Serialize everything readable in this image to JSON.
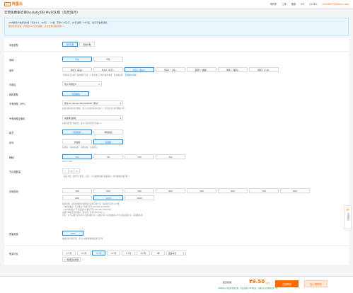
{
  "topbar": {
    "logo_mark": "(-)",
    "logo_text": "阿里云",
    "links": [
      "购物车",
      "工单",
      "备案",
      "ICP",
      "$138%",
      "a13586***@aliyun.com"
    ]
  },
  "page_title": "云原生数据仓库AnalyticDB MySQL版（包年包月）",
  "notice": {
    "line1": "ADB新用户免费领6核（可扩1.5，10天），72核（可扩1.0元/元，16天试用）73行后，最高可免费试用。",
    "line2": "限时优惠活动：开通送100元代金券，点击查看活动详情>>"
  },
  "sections": {
    "billing_label": "商品类型",
    "billing_options": [
      "包年包月",
      "按量付费"
    ],
    "region_label": "地域",
    "region_top": [
      "华北",
      "华东"
    ],
    "region_sub_label": "城市",
    "region_options": [
      "华北1（青岛）",
      "华北2（北京）",
      "华东1（杭州）",
      "华东2（上海）",
      "西南1（成都）",
      "华南1（深圳）",
      "华南3（广州）"
    ],
    "region_hint": "不同地域之间的产品内网不互通，订单生效后不支持更换地域，请谨慎选择。",
    "region_hint_link": "查看我的地域",
    "zone_label": "可用区",
    "zone_value": "杭州 可用区H",
    "network_label": "网络类型",
    "network_option": "专有网络",
    "vpc_label": "专有网络（VPC）",
    "vpc_value": "默认vpc-bp1vpcl6xp3sz9k0t（默认）",
    "vpc_hint": "如需创建新的专有网络，您可以前往控制台创建>> 当前仅支持专有网络VPC。",
    "vswitch_label": "专有网络交换机",
    "vswitch_value": "请选择交换机",
    "vswitch_hint": "如需创建新的交换机，您可以前往控制台创建>>",
    "mode_label": "模式",
    "mode_options": [
      "预留模式",
      "弹性模式"
    ],
    "series_label": "系列",
    "series_options": [
      "高性能",
      "基础版"
    ],
    "series_hint": "基础版，单副本集群，免费试用，价格便宜。",
    "spec_label": "规格",
    "spec_options": [
      "T32",
      "T8",
      "T16",
      "T52"
    ],
    "spec_hint": "C8N 1.5GB",
    "node_label": "节点组数量",
    "node_value": "1",
    "node_hint": "（最多5组，选择节点数目，注意：节点组数目越多性能越好，请您根据需要选择。）",
    "storage_label": "存储空间",
    "storage_row1": [
      "100",
      "200",
      "300",
      "400",
      "500",
      "600",
      "700",
      "800"
    ],
    "storage_row2": [
      "900",
      "1000",
      "2000"
    ],
    "storage_hint1": "规格说明：主机规格中存储容量为实际可用空间，按存储空间大小计费。",
    "storage_hint2": "- C8N规格每个节点组最大存储空间为1000GB-10000GB。",
    "storage_hint3": "- C32N规格每个节点组最大存储空间为2000GB-10000GB。",
    "storage_hint4": "存储空间越大性能越好，建议至少选择1000GB以上。",
    "storage_hint5": "注意：以上存储空间为单节点组存储空间，存储空间=节点组数量×单节点组存储空间，请谨慎选择。",
    "backup_label": "预留资源",
    "backup_value": "1000",
    "backup_hint": "数据备份存储空间，您可以根据数据规模进行选择。",
    "duration_label": "购买时长",
    "duration_options": [
      "1个月",
      "2个月",
      "3个月",
      "4个月",
      "5个月",
      "6个月",
      "1年"
    ],
    "duration_select": "更多时长",
    "autorenew_label": "到期自动续费"
  },
  "bottom": {
    "price_label": "配置费用：",
    "price": "¥9.50",
    "price_unit": "元/月",
    "price_sub": "ADB体验与测试时免费试用，详情请参考 ADB文档，开通后可以免费享受1个月。",
    "buy_label": "立即购买",
    "cart_label": "加入购物车"
  },
  "float": {
    "label": "咨询建议"
  }
}
